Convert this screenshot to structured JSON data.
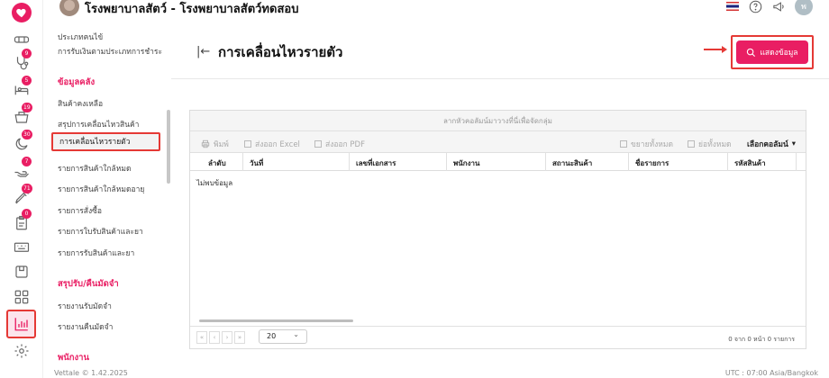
{
  "app": {
    "title": "โรงพยาบาลสัตว์ - โรงพยาบาลสัตว์ทดสอบ",
    "user_initial": "พ"
  },
  "rail": {
    "badges": [
      "9",
      "5",
      "19",
      "30",
      "7",
      "71",
      "0"
    ]
  },
  "menu": {
    "top_items": [
      "ประเภทคนไข้",
      "การรับเงินตามประเภทการชำระ"
    ],
    "sections": [
      {
        "title": "ข้อมูลคลัง",
        "items": [
          "สินค้าคงเหลือ",
          "สรุปการเคลื่อนไหวสินค้า",
          "การเคลื่อนไหวรายตัว",
          "รายการสินค้าใกล้หมด",
          "รายการสินค้าใกล้หมดอายุ",
          "รายการสั่งซื้อ",
          "รายการใบรับสินค้าและยา",
          "รายการรับสินค้าและยา"
        ]
      },
      {
        "title": "สรุปรับ/คืนมัดจำ",
        "items": [
          "รายงานรับมัดจำ",
          "รายงานคืนมัดจำ"
        ]
      },
      {
        "title": "พนักงาน",
        "items": []
      }
    ],
    "selected": "การเคลื่อนไหวรายตัว"
  },
  "page": {
    "title": "การเคลื่อนไหวรายตัว",
    "show_button": "แสดงข้อมูล"
  },
  "grid": {
    "group_hint": "ลากหัวคอลัมน์มาวางที่นี่เพื่อจัดกลุ่ม",
    "toolbar": {
      "print": "พิมพ์",
      "export_excel": "ส่งออก Excel",
      "export_pdf": "ส่งออก PDF",
      "expand_all": "ขยายทั้งหมด",
      "collapse_all": "ย่อทั้งหมด",
      "choose_columns": "เลือกคอลัมน์"
    },
    "columns": [
      "ลำดับ",
      "วันที่",
      "เลขที่เอกสาร",
      "พนักงาน",
      "สถานะสินค้า",
      "ชื่อรายการ",
      "รหัสสินค้า"
    ],
    "empty_text": "ไม่พบข้อมูล",
    "pager": {
      "page_size": "20",
      "info": "0 จาก 0 หน้า 0 รายการ"
    }
  },
  "footer": {
    "left": "Vettale © 1.42.2025",
    "right": "UTC : 07:00 Asia/Bangkok"
  },
  "colors": {
    "accent": "#e91e63",
    "highlight": "#e53935"
  }
}
